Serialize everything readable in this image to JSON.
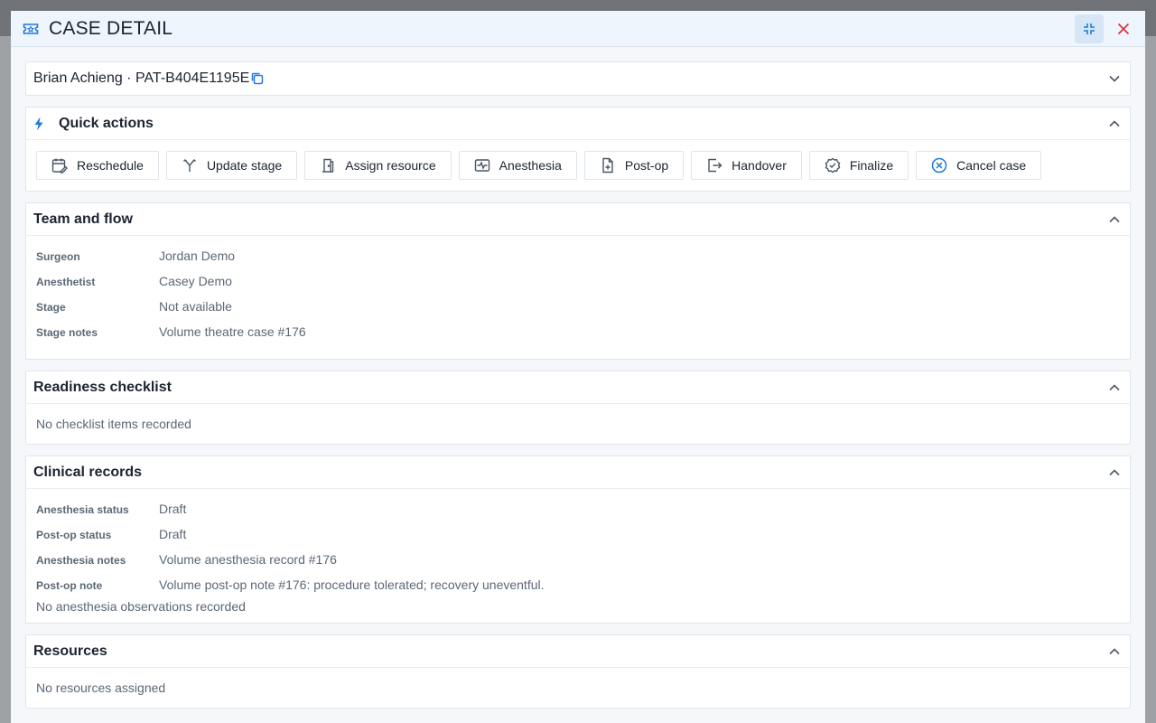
{
  "modal": {
    "title": "CASE DETAIL",
    "patient_header": "Brian Achieng · PAT-B404E1195E"
  },
  "quick_actions": {
    "title": "Quick actions",
    "buttons": [
      {
        "label": "Reschedule",
        "icon": "calendar-edit-icon"
      },
      {
        "label": "Update stage",
        "icon": "stage-branch-icon"
      },
      {
        "label": "Assign resource",
        "icon": "door-icon"
      },
      {
        "label": "Anesthesia",
        "icon": "monitor-wave-icon"
      },
      {
        "label": "Post-op",
        "icon": "file-plus-icon"
      },
      {
        "label": "Handover",
        "icon": "handover-icon"
      },
      {
        "label": "Finalize",
        "icon": "badge-check-icon"
      },
      {
        "label": "Cancel case",
        "icon": "circle-x-icon"
      }
    ]
  },
  "team_flow": {
    "title": "Team and flow",
    "rows": [
      {
        "label": "Surgeon",
        "value": "Jordan Demo"
      },
      {
        "label": "Anesthetist",
        "value": "Casey Demo"
      },
      {
        "label": "Stage",
        "value": "Not available"
      },
      {
        "label": "Stage notes",
        "value": "Volume theatre case #176"
      }
    ]
  },
  "readiness": {
    "title": "Readiness checklist",
    "empty": "No checklist items recorded"
  },
  "clinical": {
    "title": "Clinical records",
    "rows": [
      {
        "label": "Anesthesia status",
        "value": "Draft"
      },
      {
        "label": "Post-op status",
        "value": "Draft"
      },
      {
        "label": "Anesthesia notes",
        "value": "Volume anesthesia record #176"
      },
      {
        "label": "Post-op note",
        "value": "Volume post-op note #176: procedure tolerated; recovery uneventful."
      }
    ],
    "empty": "No anesthesia observations recorded"
  },
  "resources": {
    "title": "Resources",
    "empty": "No resources assigned"
  },
  "colors": {
    "accent": "#1e7ad9",
    "close": "#d9363e",
    "header_bg": "#eef5fc"
  }
}
